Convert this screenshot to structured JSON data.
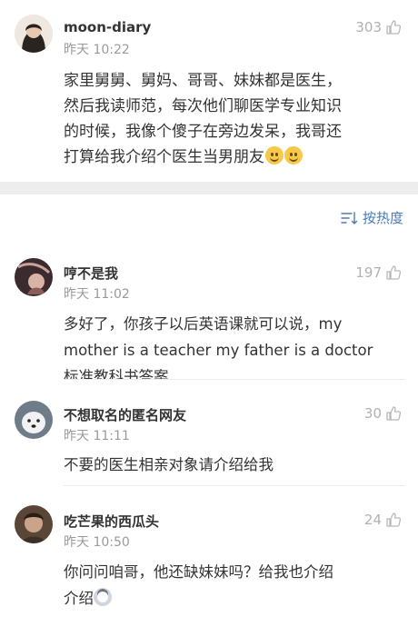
{
  "post": {
    "username": "moon-diary",
    "time": "昨天 10:22",
    "likes": "303",
    "text_lines": [
      "家里舅舅、舅妈、哥哥、妹妹都是医生，",
      "然后我读师范，每次他们聊医学专业知识",
      "的时候，我像个傻子在旁边发呆，我哥还",
      "打算给我介绍个医生当男朋友"
    ]
  },
  "sort": {
    "label": "按热度"
  },
  "comments": [
    {
      "username": "哼不是我",
      "time": "昨天 11:02",
      "likes": "197",
      "lines": [
        "多好了，你孩子以后英语课就可以说，my",
        "mother is a teacher my father is a doctor",
        "标准教科书答案"
      ]
    },
    {
      "username": "不想取名的匿名网友",
      "time": "昨天 11:11",
      "likes": "30",
      "lines": [
        "不要的医生相亲对象请介绍给我"
      ]
    },
    {
      "username": "吃芒果的西瓜头",
      "time": "昨天 10:50",
      "likes": "24",
      "lines": [
        "你问问咱哥，他还缺妹妹吗？给我也介绍",
        "介绍"
      ]
    }
  ],
  "colors": {
    "link": "#4a7bb7",
    "meta": "#9a9a9a",
    "separator": "#ededed"
  },
  "icons": [
    "thumb-up-icon",
    "sort-icon",
    "smile-emoji",
    "husky-emoji"
  ]
}
